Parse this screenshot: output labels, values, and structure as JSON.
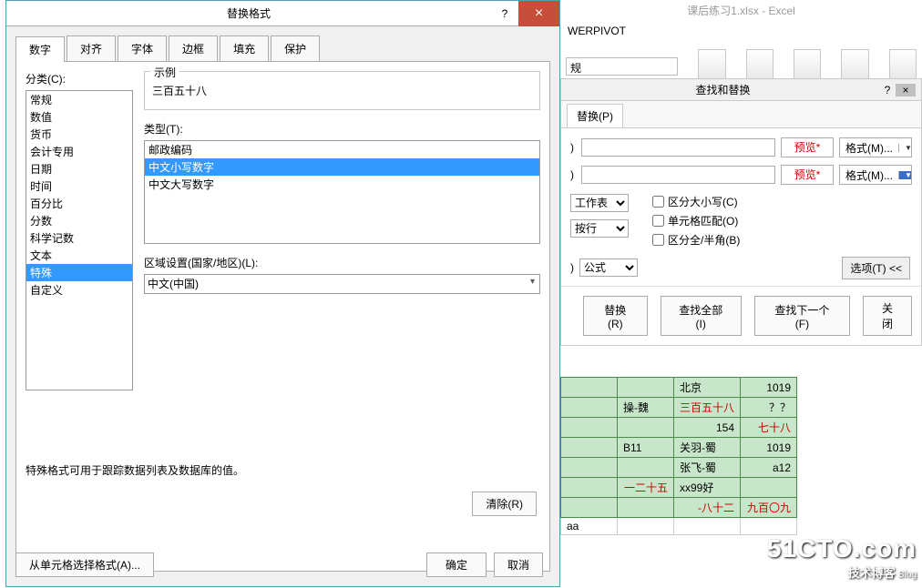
{
  "excel": {
    "title": "课后练习1.xlsx - Excel",
    "ribbonTab": "WERPIVOT",
    "styleCombo": "规"
  },
  "dialog": {
    "title": "替换格式",
    "help": "?",
    "close": "×",
    "tabs": [
      "数字",
      "对齐",
      "字体",
      "边框",
      "填充",
      "保护"
    ],
    "categoryLabel": "分类(C):",
    "categories": [
      "常规",
      "数值",
      "货币",
      "会计专用",
      "日期",
      "时间",
      "百分比",
      "分数",
      "科学记数",
      "文本",
      "特殊",
      "自定义"
    ],
    "categorySelected": "特殊",
    "sampleLabel": "示例",
    "sampleValue": "三百五十八",
    "typeLabel": "类型(T):",
    "types": [
      "邮政编码",
      "中文小写数字",
      "中文大写数字"
    ],
    "typeSelected": "中文小写数字",
    "localeLabel": "区域设置(国家/地区)(L):",
    "localeValue": "中文(中国)",
    "note": "特殊格式可用于跟踪数据列表及数据库的值。",
    "clear": "清除(R)",
    "fromCell": "从单元格选择格式(A)...",
    "ok": "确定",
    "cancel": "取消"
  },
  "fr": {
    "title": "查找和替换",
    "help": "?",
    "close": "×",
    "tab": "替换(P)",
    "rowLabel": ")",
    "preview": "预览*",
    "formatBtn": "格式(M)...",
    "within": "工作表",
    "search": "按行",
    "lookin": "公式",
    "lookinLabel": ")",
    "chkCase": "区分大小写(C)",
    "chkCell": "单元格匹配(O)",
    "chkWidth": "区分全/半角(B)",
    "options": "选项(T) <<",
    "btnReplace": "替换(R)",
    "btnFindAll": "查找全部(I)",
    "btnFindNext": "查找下一个(F)",
    "btnClose": "关闭"
  },
  "sheet": {
    "rows": [
      [
        "",
        "",
        "北京",
        "1019"
      ],
      [
        "",
        "操-魏",
        "三百五十八",
        "？？"
      ],
      [
        "",
        "",
        "154",
        "七十八"
      ],
      [
        "",
        "B11",
        "关羽-蜀",
        "1019"
      ],
      [
        "",
        "",
        "张飞-蜀",
        "a12"
      ],
      [
        "",
        "一二十五",
        "xx99好",
        ""
      ],
      [
        "",
        "",
        "-八十二",
        "九百〇九"
      ],
      [
        "aa",
        "",
        "",
        ""
      ]
    ]
  },
  "watermark": {
    "big": "51CTO.com",
    "sm": "技术博客",
    "blog": "Blog"
  }
}
